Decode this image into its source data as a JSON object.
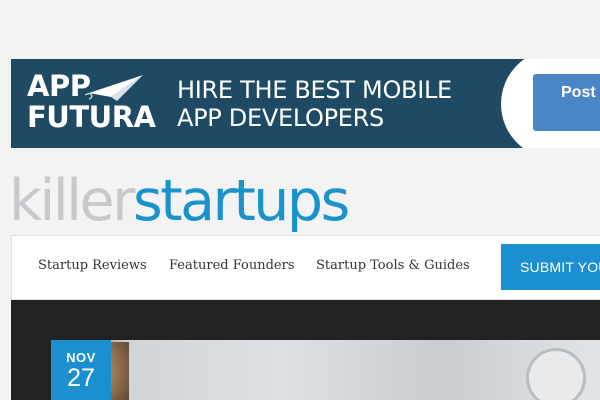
{
  "ad": {
    "logo_line1": "APP",
    "logo_line2": "FUTURA",
    "headline_line1": "HIRE THE BEST MOBILE",
    "headline_line2": "APP DEVELOPERS",
    "cta_label": "Post"
  },
  "site": {
    "logo_part1": "killer",
    "logo_part2": "startups"
  },
  "nav": {
    "items": [
      {
        "label": "Startup Reviews"
      },
      {
        "label": "Featured Founders"
      },
      {
        "label": "Startup Tools & Guides"
      }
    ],
    "submit_label": "SUBMIT YOUR"
  },
  "hero": {
    "date_month": "NOV",
    "date_day": "27"
  },
  "colors": {
    "brand_blue": "#1c8fd0",
    "ad_background": "#1e4a63",
    "logo_grey": "#c7c9cc"
  }
}
